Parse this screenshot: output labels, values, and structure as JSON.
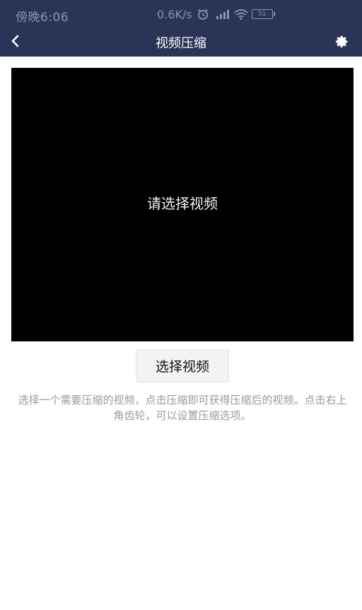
{
  "status_bar": {
    "time": "傍晚6:06",
    "network_speed": "0.6K/s",
    "battery_level": "51",
    "icons": [
      "alarm-icon",
      "signal-icon",
      "wifi-icon",
      "battery-icon"
    ]
  },
  "app_bar": {
    "title": "视频压缩",
    "back_icon": "chevron-left-icon",
    "settings_icon": "gear-icon"
  },
  "preview": {
    "placeholder": "请选择视频"
  },
  "actions": {
    "select_video_label": "选择视频"
  },
  "hint": {
    "text": "选择一个需要压缩的视频，点击压缩即可获得压缩后的视频。点击右上角齿轮，可以设置压缩选项。"
  },
  "colors": {
    "header_bg": "#2a3457",
    "preview_bg": "#000000",
    "hint_text": "#9a9a9a"
  }
}
